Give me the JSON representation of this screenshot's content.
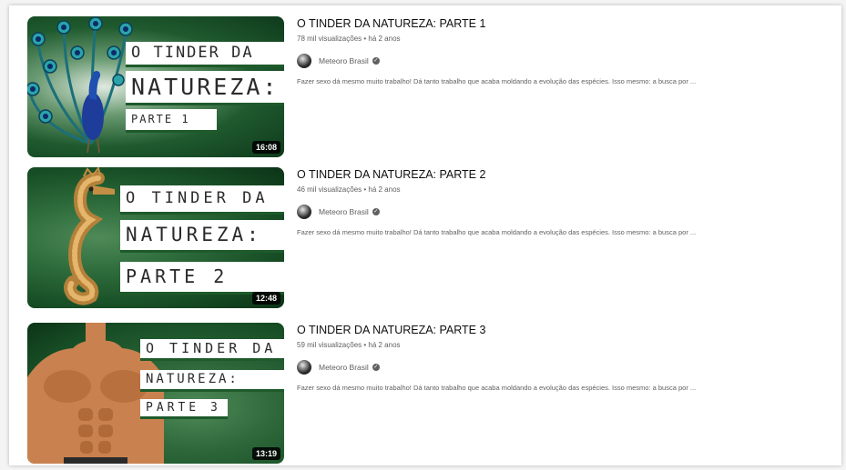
{
  "videos": [
    {
      "title": "O TINDER DA NATUREZA: PARTE 1",
      "meta": "78 mil visualizações • há 2 anos",
      "channel": "Meteoro Brasil",
      "description": "Fazer sexo dá mesmo muito trabalho! Dá tanto trabalho que acaba moldando a evolução das espécies. Isso mesmo: a busca por ...",
      "duration": "16:08",
      "thumb_lines": [
        "O TINDER DA",
        "NATUREZA:",
        "PARTE 1"
      ],
      "thumb_subject": "peacock"
    },
    {
      "title": "O TINDER DA NATUREZA: PARTE 2",
      "meta": "46 mil visualizações • há 2 anos",
      "channel": "Meteoro Brasil",
      "description": "Fazer sexo dá mesmo muito trabalho! Dá tanto trabalho que acaba moldando a evolução das espécies. Isso mesmo: a busca por ...",
      "duration": "12:48",
      "thumb_lines": [
        "O TINDER DA",
        "NATUREZA:",
        "PARTE 2"
      ],
      "thumb_subject": "seahorse"
    },
    {
      "title": "O TINDER DA NATUREZA: PARTE 3",
      "meta": "59 mil visualizações • há 2 anos",
      "channel": "Meteoro Brasil",
      "description": "Fazer sexo dá mesmo muito trabalho! Dá tanto trabalho que acaba moldando a evolução das espécies. Isso mesmo: a busca por ...",
      "duration": "13:19",
      "thumb_lines": [
        "O TINDER DA",
        "NATUREZA:",
        "PARTE 3"
      ],
      "thumb_subject": "shirtless-man"
    }
  ],
  "icons": {
    "verified": "verified-check-icon",
    "avatar": "channel-avatar"
  },
  "colors": {
    "thumb_green": "#1f5a2e",
    "text_primary": "#0f0f0f",
    "text_secondary": "#606060"
  }
}
